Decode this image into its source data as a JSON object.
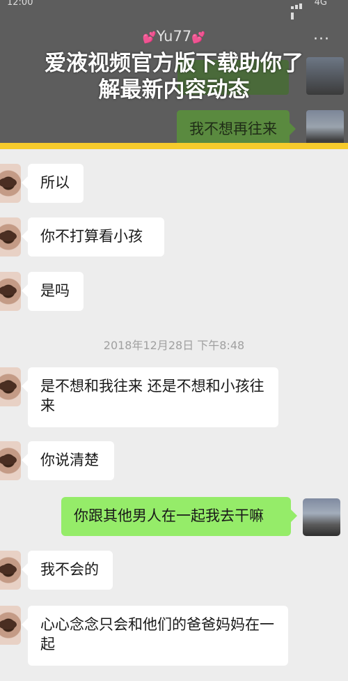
{
  "status": {
    "time": "12:00",
    "network": "4G"
  },
  "header": {
    "contact_name": "Yu77",
    "more": "···"
  },
  "banner": {
    "line1": "爱液视频官方版下载助你了",
    "line2": "解最新内容动态"
  },
  "colors": {
    "banner_rule": "#f6cb2c",
    "bubble_green": "#95ec69",
    "bubble_white": "#ffffff",
    "background": "#ededed"
  },
  "messages": [
    {
      "side": "right",
      "text": "我不想再往来"
    },
    {
      "side": "left",
      "text": "所以"
    },
    {
      "side": "left",
      "text": "你不打算看小孩"
    },
    {
      "side": "left",
      "text": "是吗"
    },
    {
      "side": "left",
      "text": "是不想和我往来 还是不想和小孩往来"
    },
    {
      "side": "left",
      "text": "你说清楚"
    },
    {
      "side": "right",
      "text": "你跟其他男人在一起我去干嘛"
    },
    {
      "side": "left",
      "text": "我不会的"
    },
    {
      "side": "left",
      "text": "心心念念只会和他们的爸爸妈妈在一起"
    }
  ],
  "timestamp": "2018年12月28日 下午8:48"
}
